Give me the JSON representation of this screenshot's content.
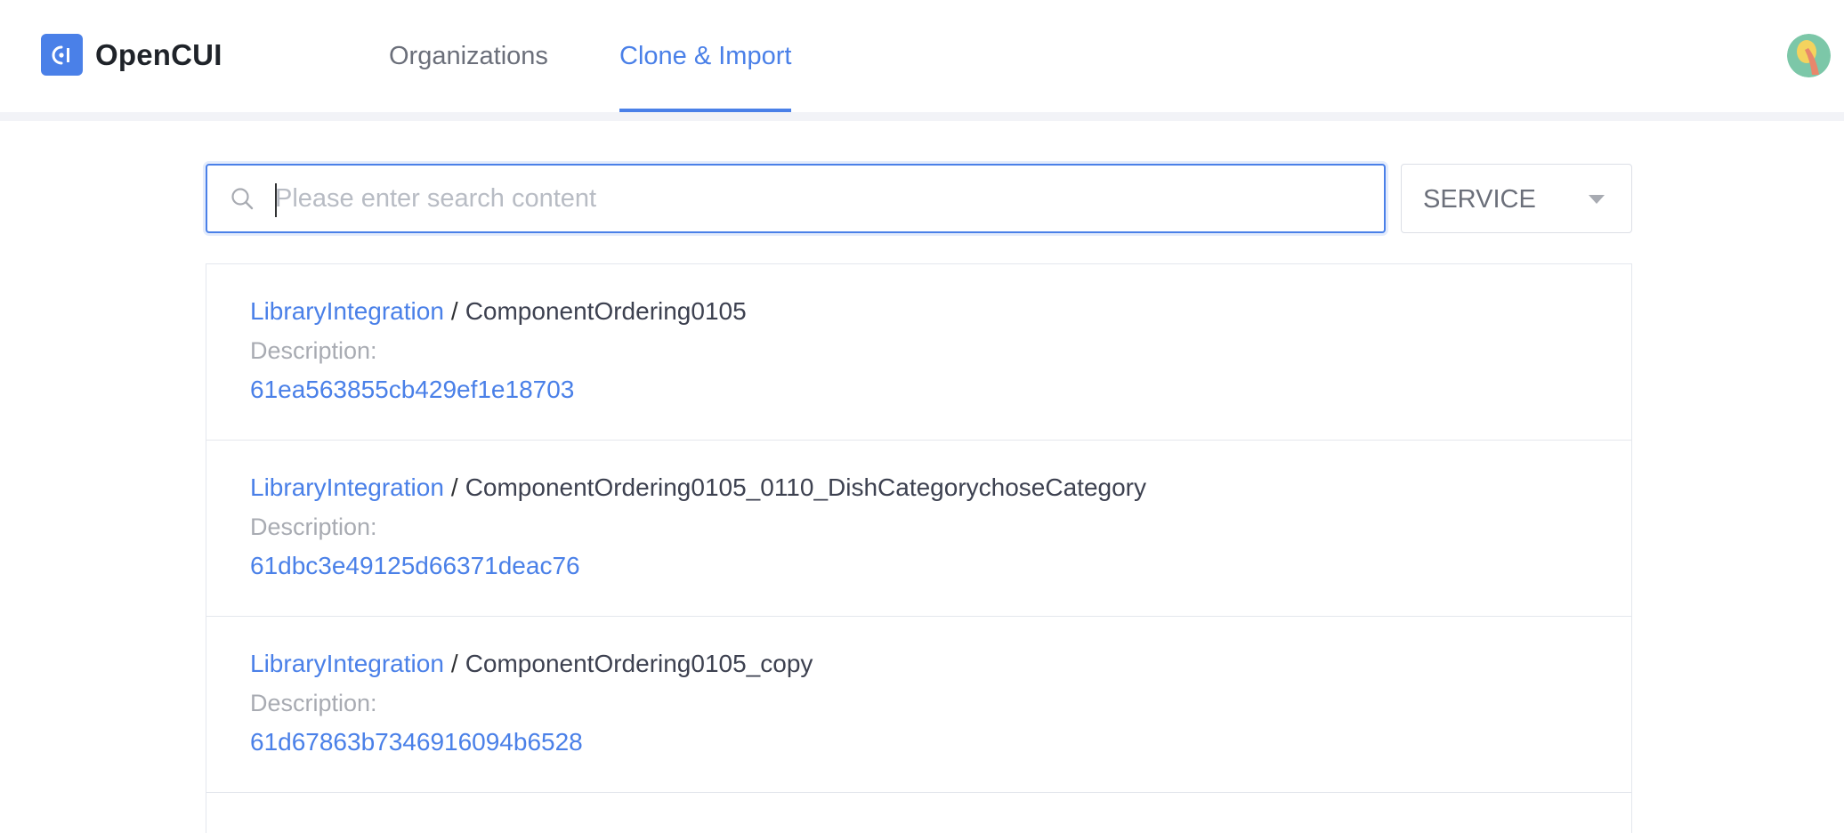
{
  "header": {
    "app_name": "OpenCUI",
    "tabs": [
      {
        "label": "Organizations",
        "active": false
      },
      {
        "label": "Clone & Import",
        "active": true
      }
    ]
  },
  "search": {
    "placeholder": "Please enter search content",
    "value": ""
  },
  "type_filter": {
    "selected": "SERVICE"
  },
  "results": [
    {
      "org": "LibraryIntegration",
      "separator": "/",
      "project": "ComponentOrdering0105",
      "description_label": "Description:",
      "id": "61ea563855cb429ef1e18703"
    },
    {
      "org": "LibraryIntegration",
      "separator": "/",
      "project": "ComponentOrdering0105_0110_DishCategorychoseCategory",
      "description_label": "Description:",
      "id": "61dbc3e49125d66371deac76"
    },
    {
      "org": "LibraryIntegration",
      "separator": "/",
      "project": "ComponentOrdering0105_copy",
      "description_label": "Description:",
      "id": "61d67863b7346916094b6528"
    }
  ],
  "colors": {
    "accent": "#4a80e8",
    "link": "#4a80e8",
    "muted": "#a8abb2",
    "border": "#e4e7ed"
  }
}
